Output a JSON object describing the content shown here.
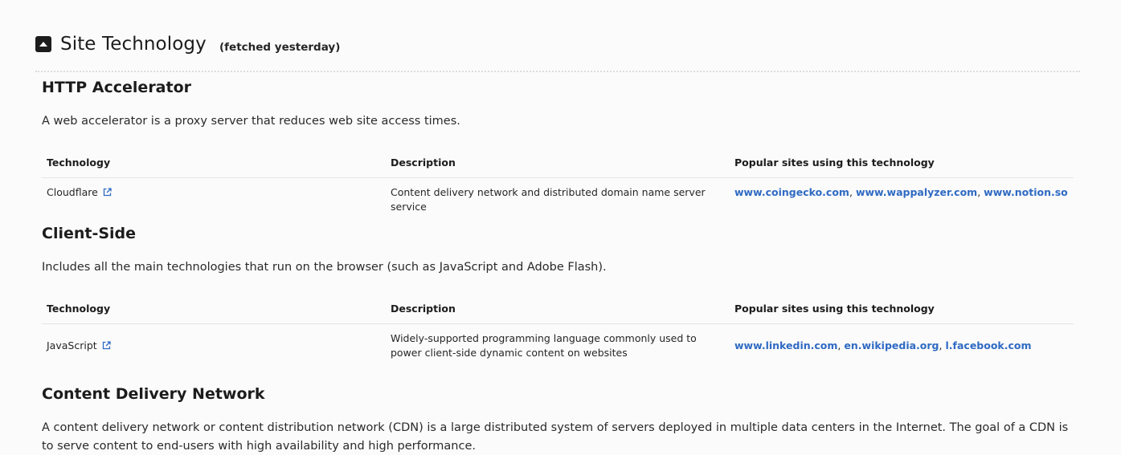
{
  "header": {
    "title": "Site Technology",
    "fetched": "(fetched yesterday)"
  },
  "table_headers": {
    "technology": "Technology",
    "description": "Description",
    "popular": "Popular sites using this technology"
  },
  "sections": [
    {
      "title": "HTTP Accelerator",
      "description": "A web accelerator is a proxy server that reduces web site access times.",
      "rows": [
        {
          "technology": "Cloudflare",
          "description": "Content delivery network and distributed domain name server service",
          "sites": [
            "www.coingecko.com",
            "www.wappalyzer.com",
            "www.notion.so"
          ]
        }
      ]
    },
    {
      "title": "Client-Side",
      "description": "Includes all the main technologies that run on the browser (such as JavaScript and Adobe Flash).",
      "rows": [
        {
          "technology": "JavaScript",
          "description": "Widely-supported programming language commonly used to power client-side dynamic content on websites",
          "sites": [
            "www.linkedin.com",
            "en.wikipedia.org",
            "l.facebook.com"
          ]
        }
      ]
    },
    {
      "title": "Content Delivery Network",
      "description": "A content delivery network or content distribution network (CDN) is a large distributed system of servers deployed in multiple data centers in the Internet. The goal of a CDN is to serve content to end-users with high availability and high performance."
    }
  ],
  "colors": {
    "link": "#2f6ac3",
    "text": "#262626",
    "background": "#fbfbfb"
  }
}
